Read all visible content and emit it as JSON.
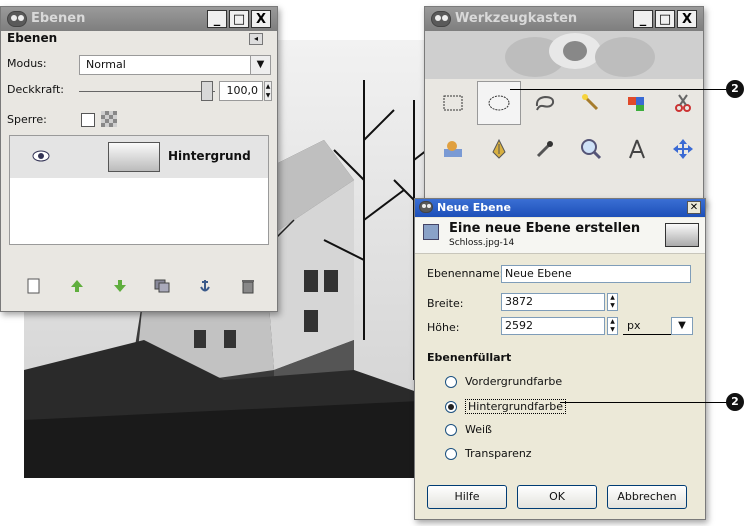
{
  "layers_window": {
    "title": "Ebenen",
    "section_title": "Ebenen",
    "mode_label": "Modus:",
    "mode_value": "Normal",
    "opacity_label": "Deckkraft:",
    "opacity_value": "100,0",
    "lock_label": "Sperre:",
    "layers": [
      {
        "name": "Hintergrund",
        "visible": true
      }
    ],
    "title_buttons": [
      "_",
      "□",
      "X"
    ]
  },
  "toolbox_window": {
    "title": "Werkzeugkasten",
    "title_buttons": [
      "_",
      "□",
      "X"
    ],
    "tools": [
      {
        "icon": "rect-select-icon"
      },
      {
        "icon": "ellipse-select-icon",
        "active": true
      },
      {
        "icon": "free-select-icon"
      },
      {
        "icon": "fuzzy-select-icon"
      },
      {
        "icon": "color-select-icon"
      },
      {
        "icon": "scissors-select-icon"
      },
      {
        "icon": "foreground-select-icon"
      },
      {
        "icon": "paths-icon"
      },
      {
        "icon": "color-picker-icon"
      },
      {
        "icon": "zoom-icon"
      },
      {
        "icon": "measure-icon"
      },
      {
        "icon": "move-icon"
      }
    ]
  },
  "new_layer_dialog": {
    "title": "Neue Ebene",
    "heading": "Eine neue Ebene erstellen",
    "subtitle": "Schloss.jpg-14",
    "name_label": "Ebenenname:",
    "name_value": "Neue Ebene",
    "width_label": "Breite:",
    "width_value": "3872",
    "height_label": "Höhe:",
    "height_value": "2592",
    "unit_value": "px",
    "fill_title": "Ebenenfüllart",
    "fill_options": [
      {
        "label": "Vordergrundfarbe",
        "checked": false
      },
      {
        "label": "Hintergrundfarbe",
        "checked": true
      },
      {
        "label": "Weiß",
        "checked": false
      },
      {
        "label": "Transparenz",
        "checked": false
      }
    ],
    "buttons": {
      "help": "Hilfe",
      "ok": "OK",
      "cancel": "Abbrechen"
    }
  },
  "callouts": [
    "2",
    "2"
  ],
  "colors": {
    "xp_title_blue": "#1d4fb8",
    "gimp_title_grey": "#8a8a8a",
    "dialog_bg": "#ece9d8"
  }
}
